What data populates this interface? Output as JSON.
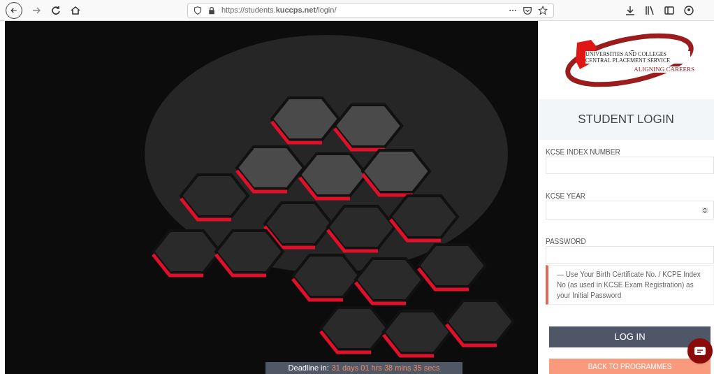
{
  "browser": {
    "url": "https://students.**kuccps.net**/login/"
  },
  "logo": {
    "tagline": "UNIVERSITIES AND COLLEGES CENTRAL PLACEMENT SERVICE",
    "motto": "ALIGNING CAREERS"
  },
  "login": {
    "title": "STUDENT LOGIN",
    "fields": [
      {
        "label": "KCSE INDEX NUMBER",
        "kind": "text"
      },
      {
        "label": "KCSE YEAR",
        "kind": "number"
      },
      {
        "label": "PASSWORD",
        "kind": "password"
      }
    ],
    "note": "— Use Your Birth Certificate No. / KCPE Index No (as used in KCSE Exam Registration) as your Initial Password",
    "buttons": [
      {
        "label": "LOG IN",
        "kind": "primary"
      },
      {
        "label": "BACK TO PROGRAMMES",
        "kind": "secondary"
      }
    ]
  },
  "deadline": {
    "label": "Deadline in:",
    "value": "31 days 01 hrs 38 mins 35 secs"
  }
}
